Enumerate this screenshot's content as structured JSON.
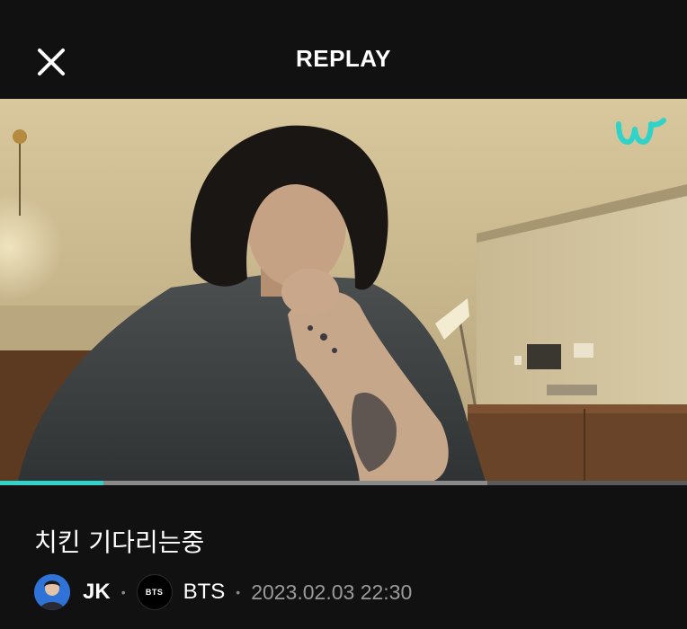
{
  "header": {
    "title": "REPLAY",
    "close_icon": "close-icon"
  },
  "video": {
    "brand_icon": "weverse-logo-icon",
    "progress_fraction": 0.15,
    "buffered_fraction": 0.71
  },
  "post": {
    "title": "치킨 기다리는중",
    "artist": {
      "name": "JK",
      "avatar_icon": "artist-avatar"
    },
    "community": {
      "logo_text": "BTS",
      "name": "BTS"
    },
    "timestamp": "2023.02.03 22:30"
  },
  "colors": {
    "background": "#111111",
    "accent": "#2fd3c7",
    "meta_text": "#9a9a9a"
  }
}
